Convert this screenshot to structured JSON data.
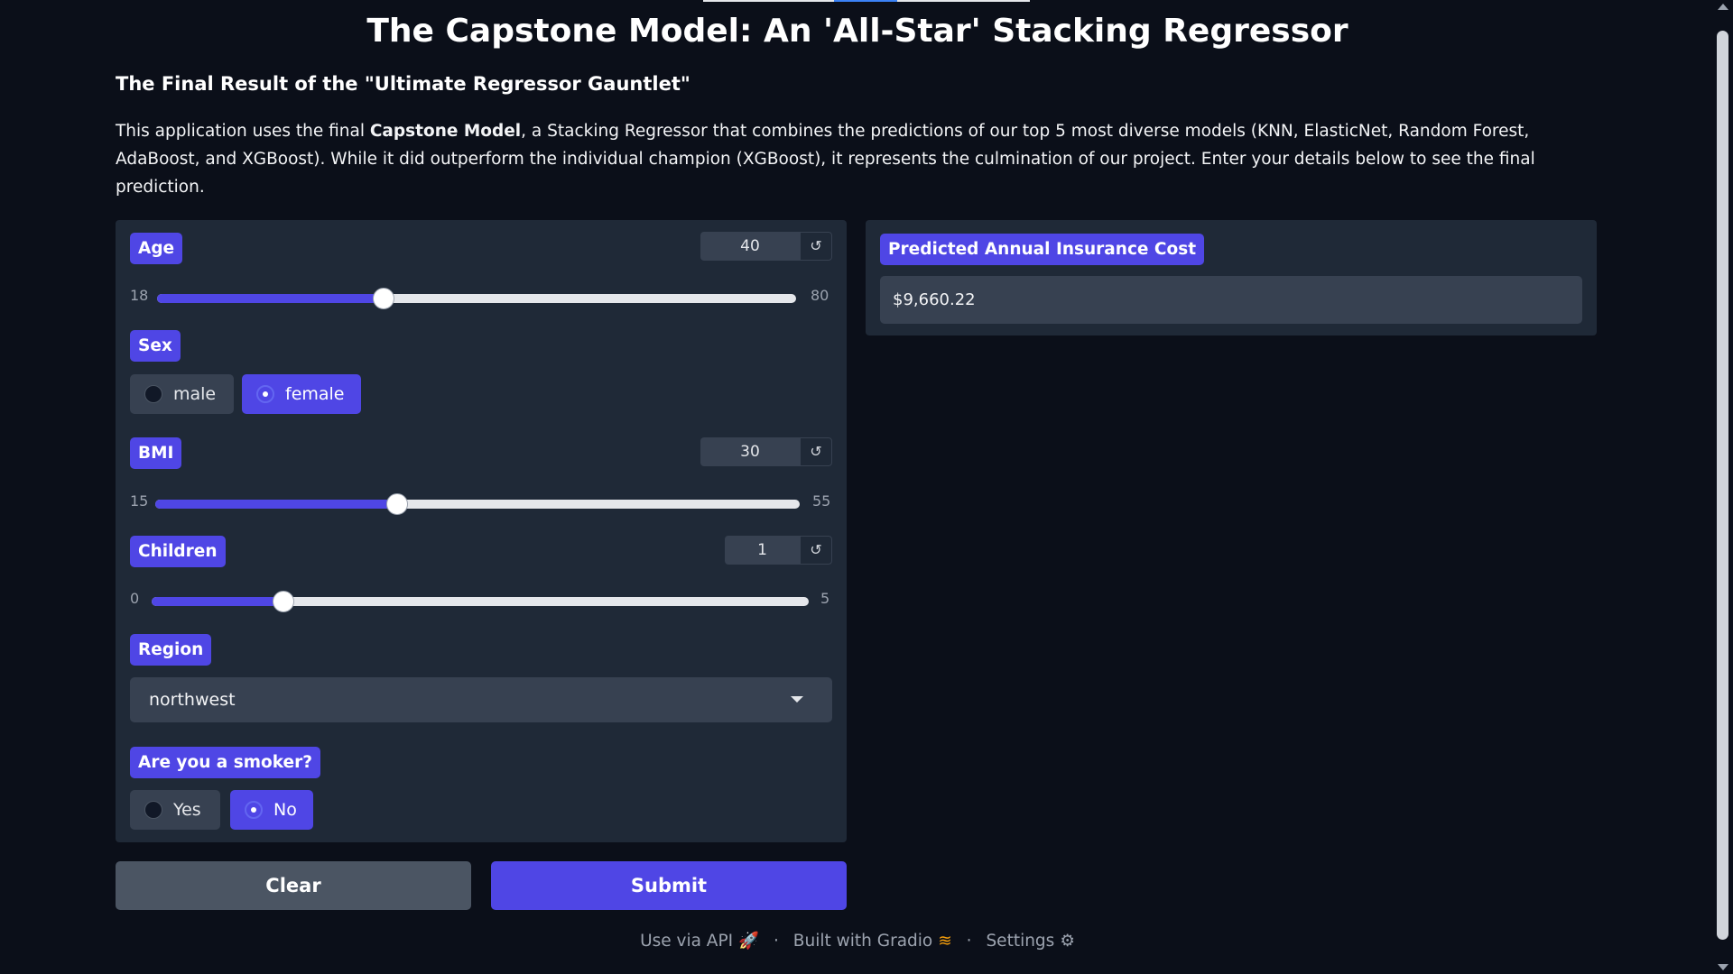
{
  "app": {
    "title": "The Capstone Model: An 'All-Star' Stacking Regressor",
    "subtitle": "The Final Result of the \"Ultimate Regressor Gauntlet\"",
    "description_prefix": "This application uses the final ",
    "description_bold": "Capstone Model",
    "description_suffix": ", a Stacking Regressor that combines the predictions of our top 5 most diverse models (KNN, ElasticNet, Random Forest, AdaBoost, and XGBoost). While it did outperform the individual champion (XGBoost), it represents the culmination of our project. Enter your details below to see the final prediction."
  },
  "inputs": {
    "age": {
      "label": "Age",
      "value": "40",
      "min": "18",
      "max": "80",
      "fraction": 0.355
    },
    "sex": {
      "label": "Sex",
      "options": [
        "male",
        "female"
      ],
      "selected": "female"
    },
    "bmi": {
      "label": "BMI",
      "value": "30",
      "min": "15",
      "max": "55",
      "fraction": 0.375
    },
    "children": {
      "label": "Children",
      "value": "1",
      "min": "0",
      "max": "5",
      "fraction": 0.2
    },
    "region": {
      "label": "Region",
      "value": "northwest"
    },
    "smoker": {
      "label": "Are you a smoker?",
      "options": [
        "Yes",
        "No"
      ],
      "selected": "No"
    }
  },
  "reset_icon": "↺",
  "output": {
    "label": "Predicted Annual Insurance Cost",
    "value": "$9,660.22"
  },
  "buttons": {
    "clear": "Clear",
    "submit": "Submit"
  },
  "footer": {
    "api": "Use via API",
    "api_icon": "rocket-icon",
    "built": "Built with Gradio",
    "built_icon": "gradio-logo-icon",
    "settings": "Settings",
    "settings_icon": "gear-icon",
    "separator": "·"
  },
  "colors": {
    "accent": "#4f46e5",
    "panel": "#1f2937",
    "background": "#0b0f19"
  }
}
